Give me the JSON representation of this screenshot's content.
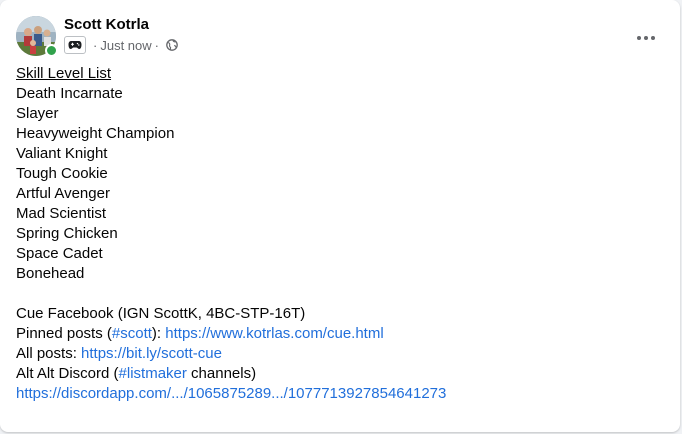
{
  "post": {
    "author": "Scott Kotrla",
    "timestamp": "Just now",
    "meta_separator": "·",
    "audience_icon": "globe-icon",
    "badge_icon": "game-controller-icon",
    "more_icon": "more-options-icon",
    "online_color": "#31a24c",
    "link_color": "#216fdb"
  },
  "body": {
    "list_title": "Skill Level List",
    "skill_levels": [
      "Death Incarnate",
      "Slayer",
      "Heavyweight Champion",
      "Valiant Knight",
      "Tough Cookie",
      "Artful Avenger",
      "Mad Scientist",
      "Spring Chicken",
      "Space Cadet",
      "Bonehead"
    ],
    "cue_line": "Cue Facebook (IGN ScottK, 4BC-STP-16T)",
    "pinned": {
      "prefix": "Pinned posts (",
      "hashtag": "#scott",
      "middle": "): ",
      "url": "https://www.kotrlas.com/cue.html"
    },
    "all_posts": {
      "prefix": "All posts: ",
      "url": "https://bit.ly/scott-cue"
    },
    "discord": {
      "prefix": "Alt Alt Discord (",
      "hashtag": "#listmaker",
      "suffix": " channels)",
      "url": "https://discordapp.com/.../1065875289.../1077713927854641273"
    }
  }
}
